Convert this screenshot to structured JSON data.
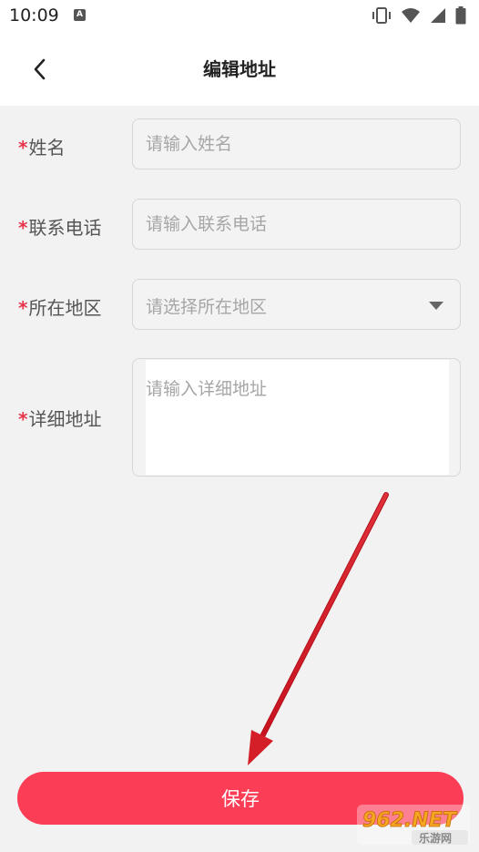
{
  "status_bar": {
    "time": "10:09",
    "app_icon_letter": "A",
    "icons": [
      "vibrate-icon",
      "wifi-icon",
      "signal-icon",
      "battery-icon"
    ]
  },
  "nav": {
    "title": "编辑地址",
    "back_icon": "chevron-left-icon"
  },
  "form": {
    "required_mark": "*",
    "name": {
      "label": "姓名",
      "placeholder": "请输入姓名"
    },
    "phone": {
      "label": "联系电话",
      "placeholder": "请输入联系电话"
    },
    "region": {
      "label": "所在地区",
      "placeholder": "请选择所在地区",
      "icon": "caret-down-icon"
    },
    "address": {
      "label": "详细地址",
      "placeholder": "请输入详细地址"
    }
  },
  "save_button": {
    "label": "保存"
  },
  "watermark": {
    "brand": "962.NET",
    "subtext": "乐游网"
  },
  "colors": {
    "accent": "#fb3d56",
    "required": "#e8334a",
    "background": "#f2f2f2",
    "annotation_arrow": "#d8242f"
  }
}
